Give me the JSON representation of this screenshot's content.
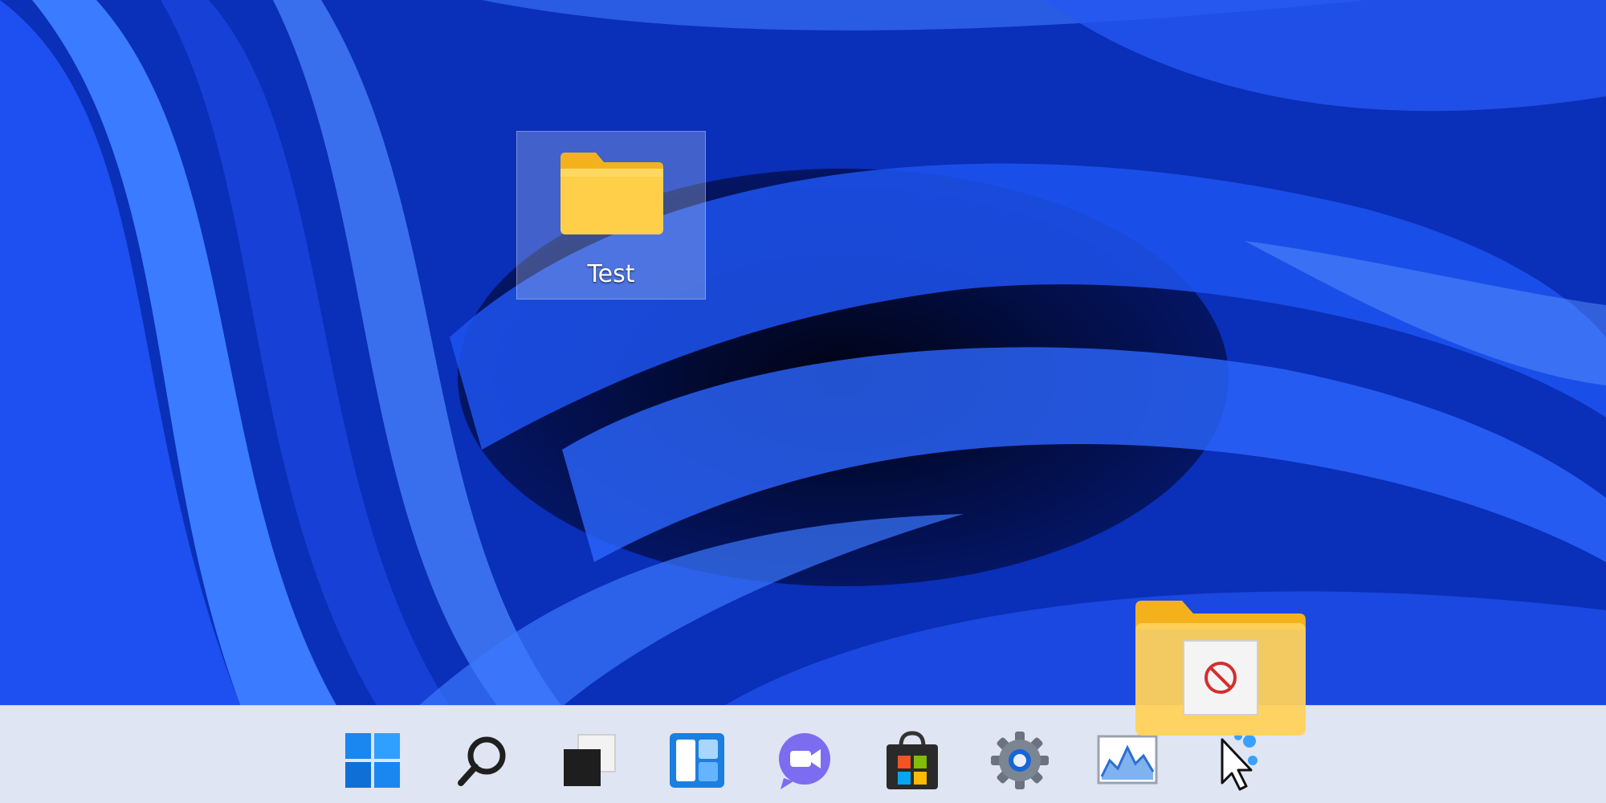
{
  "desktop": {
    "icons": [
      {
        "label": "Test",
        "icon": "folder-icon",
        "selected": true
      }
    ]
  },
  "drag": {
    "ghost_icon": "folder-icon",
    "cursor_badge": "no-drop-icon"
  },
  "taskbar": {
    "items": [
      {
        "icon": "windows-start-icon"
      },
      {
        "icon": "search-icon"
      },
      {
        "icon": "task-view-icon"
      },
      {
        "icon": "widgets-icon"
      },
      {
        "icon": "chat-icon"
      },
      {
        "icon": "store-icon"
      },
      {
        "icon": "settings-icon"
      },
      {
        "icon": "performance-monitor-icon"
      },
      {
        "icon": "app-cursor-icon"
      }
    ]
  },
  "colors": {
    "folder_yellow": "#ffcf4a",
    "folder_tab": "#f3b21c",
    "taskbar_bg": "#dfe5f2",
    "accent_blue": "#0a5fd8"
  }
}
